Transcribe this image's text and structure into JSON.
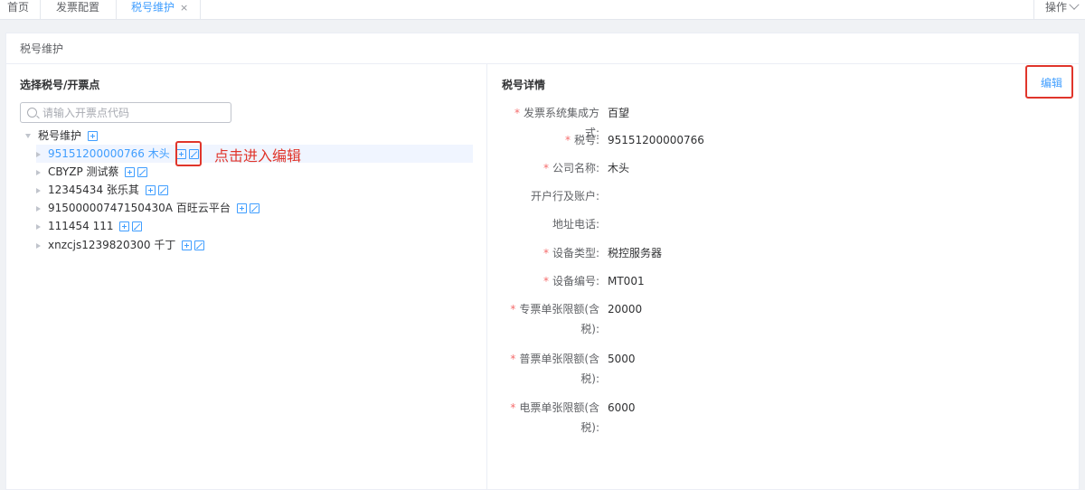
{
  "tabs": {
    "home": "首页",
    "invoice_config": "发票配置",
    "tax_maint": "税号维护",
    "close_glyph": "×",
    "ops": "操作"
  },
  "card": {
    "title": "税号维护"
  },
  "left": {
    "heading": "选择税号/开票点",
    "search_placeholder": "请输入开票点代码",
    "root_label": "税号维护",
    "nodes": [
      {
        "label": "95151200000766 木头",
        "selected": true
      },
      {
        "label": "CBYZP 测试蔡"
      },
      {
        "label": "12345434 张乐其"
      },
      {
        "label": "91500000747150430A 百旺云平台"
      },
      {
        "label": "111454 111"
      },
      {
        "label": "xnzcjs1239820300 千丁"
      }
    ],
    "annotation": "点击进入编辑"
  },
  "right": {
    "heading": "税号详情",
    "edit_label": "编辑",
    "fields": [
      {
        "label": "发票系统集成方式:",
        "required": true,
        "value": "百望"
      },
      {
        "label": "税号:",
        "required": true,
        "value": "95151200000766"
      },
      {
        "label": "公司名称:",
        "required": true,
        "value": "木头"
      },
      {
        "label": "开户行及账户:",
        "required": false,
        "value": ""
      },
      {
        "label": "地址电话:",
        "required": false,
        "value": ""
      },
      {
        "label": "设备类型:",
        "required": true,
        "value": "税控服务器"
      },
      {
        "label": "设备编号:",
        "required": true,
        "value": "MT001"
      },
      {
        "label": "专票单张限额(含",
        "label2": "税):",
        "required": true,
        "value": "20000"
      },
      {
        "label": "普票单张限额(含",
        "label2": "税):",
        "required": true,
        "value": "5000"
      },
      {
        "label": "电票单张限额(含",
        "label2": "税):",
        "required": true,
        "value": "6000"
      }
    ],
    "required_mark": "*"
  },
  "colors": {
    "accent": "#409eff",
    "annotation": "#e0352b",
    "required": "#f56c6c"
  }
}
